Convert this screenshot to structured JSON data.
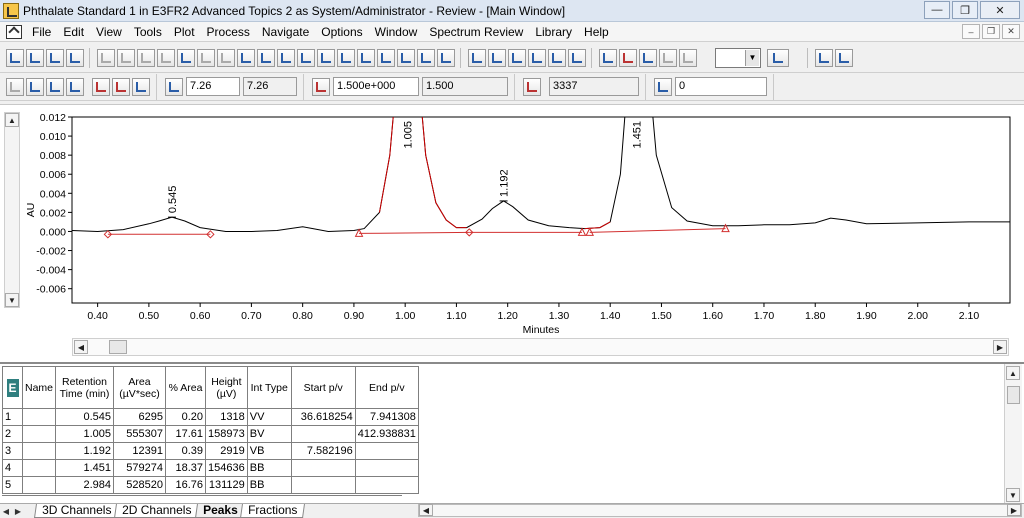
{
  "window": {
    "title": "Phthalate Standard 1 in E3FR2 Advanced Topics 2 as System/Administrator - Review - [Main Window]"
  },
  "menu": [
    "File",
    "Edit",
    "View",
    "Tools",
    "Plot",
    "Process",
    "Navigate",
    "Options",
    "Window",
    "Spectrum Review",
    "Library",
    "Help"
  ],
  "toolbar2": {
    "time_value": "7.26",
    "time_readonly": "7.26",
    "au_value": "1.500e+000",
    "au_readonly": "1.500",
    "count_value": "3337",
    "offset_value": "0"
  },
  "chart_data": {
    "type": "line",
    "xlabel": "Minutes",
    "ylabel": "AU",
    "xlim": [
      0.35,
      2.18
    ],
    "ylim": [
      -0.0075,
      0.012
    ],
    "x_ticks": [
      "0.40",
      "0.50",
      "0.60",
      "0.70",
      "0.80",
      "0.90",
      "1.00",
      "1.10",
      "1.20",
      "1.30",
      "1.40",
      "1.50",
      "1.60",
      "1.70",
      "1.80",
      "1.90",
      "2.00",
      "2.10"
    ],
    "y_ticks": [
      "0.012",
      "0.010",
      "0.008",
      "0.006",
      "0.004",
      "0.002",
      "0.000",
      "-0.002",
      "-0.004",
      "-0.006"
    ],
    "peak_labels": [
      "0.545",
      "1.005",
      "1.192",
      "1.451"
    ],
    "peak_label_x": [
      0.545,
      1.005,
      1.192,
      1.451
    ],
    "trace": {
      "color": "#000000",
      "x": [
        0.35,
        0.4,
        0.45,
        0.5,
        0.52,
        0.545,
        0.57,
        0.6,
        0.65,
        0.7,
        0.75,
        0.8,
        0.82,
        0.85,
        0.9,
        0.92,
        0.95,
        0.97,
        0.99,
        1.005,
        1.02,
        1.04,
        1.06,
        1.08,
        1.1,
        1.12,
        1.15,
        1.17,
        1.192,
        1.21,
        1.24,
        1.28,
        1.32,
        1.35,
        1.38,
        1.4,
        1.42,
        1.44,
        1.451,
        1.47,
        1.49,
        1.52,
        1.55,
        1.6,
        1.65,
        1.7,
        1.75,
        1.8,
        1.83,
        1.86,
        1.9,
        2.0,
        2.1,
        2.18
      ],
      "y": [
        0.0001,
        0.0,
        0.0002,
        0.0008,
        0.0011,
        0.0015,
        0.0011,
        0.0004,
        0.0,
        0.0,
        0.0001,
        0.0005,
        0.0003,
        0.0,
        0.0001,
        0.0003,
        0.002,
        0.008,
        0.02,
        0.03,
        0.02,
        0.008,
        0.003,
        0.0012,
        0.0004,
        0.0004,
        0.0013,
        0.0024,
        0.0032,
        0.0026,
        0.0012,
        0.0006,
        0.0004,
        0.0003,
        0.0004,
        0.001,
        0.006,
        0.02,
        0.03,
        0.02,
        0.008,
        0.0025,
        0.0011,
        0.0006,
        0.0006,
        0.0007,
        0.0007,
        0.0009,
        0.0014,
        0.0012,
        0.0008,
        0.0009,
        0.001,
        0.001
      ]
    },
    "integration_segments": [
      {
        "color": "#cc0000",
        "x": [
          0.95,
          0.97,
          0.99,
          1.005,
          1.02,
          1.04,
          1.06,
          1.08,
          1.1,
          1.12
        ],
        "y": [
          0.002,
          0.008,
          0.02,
          0.03,
          0.02,
          0.008,
          0.003,
          0.0012,
          0.0004,
          0.0004
        ]
      },
      {
        "color": "#cc0000",
        "x": [
          1.35,
          1.38,
          1.4
        ],
        "y": [
          0.0003,
          0.0004,
          0.001
        ]
      }
    ],
    "baselines": [
      {
        "x": [
          0.42,
          0.62
        ],
        "y": [
          -0.0003,
          -0.0003
        ]
      },
      {
        "x": [
          0.91,
          1.125
        ],
        "y": [
          -0.0002,
          -0.0001
        ]
      },
      {
        "x": [
          1.125,
          1.345
        ],
        "y": [
          -0.0001,
          -0.0001
        ]
      },
      {
        "x": [
          1.36,
          1.625
        ],
        "y": [
          -0.0001,
          0.0003
        ]
      }
    ],
    "markers": [
      {
        "x": 0.42,
        "y": -0.0003,
        "shape": "diamond"
      },
      {
        "x": 0.62,
        "y": -0.0003,
        "shape": "diamond"
      },
      {
        "x": 0.91,
        "y": -0.0002,
        "shape": "triangle"
      },
      {
        "x": 1.125,
        "y": -0.0001,
        "shape": "diamond"
      },
      {
        "x": 1.345,
        "y": -0.0001,
        "shape": "triangle"
      },
      {
        "x": 1.36,
        "y": -0.0001,
        "shape": "triangle"
      },
      {
        "x": 1.625,
        "y": 0.0003,
        "shape": "triangle"
      }
    ]
  },
  "peaks_table": {
    "headers": [
      "Name",
      "Retention Time (min)",
      "Area (µV*sec)",
      "% Area",
      "Height (µV)",
      "Int Type",
      "Start p/v",
      "End p/v"
    ],
    "rows": [
      {
        "n": "1",
        "name": "",
        "rt": "0.545",
        "area": "6295",
        "pct": "0.20",
        "height": "1318",
        "type": "VV",
        "start": "36.618254",
        "end": "7.941308"
      },
      {
        "n": "2",
        "name": "",
        "rt": "1.005",
        "area": "555307",
        "pct": "17.61",
        "height": "158973",
        "type": "BV",
        "start": "",
        "end": "412.938831"
      },
      {
        "n": "3",
        "name": "",
        "rt": "1.192",
        "area": "12391",
        "pct": "0.39",
        "height": "2919",
        "type": "VB",
        "start": "7.582196",
        "end": ""
      },
      {
        "n": "4",
        "name": "",
        "rt": "1.451",
        "area": "579274",
        "pct": "18.37",
        "height": "154636",
        "type": "BB",
        "start": "",
        "end": ""
      },
      {
        "n": "5",
        "name": "",
        "rt": "2.984",
        "area": "528520",
        "pct": "16.76",
        "height": "131129",
        "type": "BB",
        "start": "",
        "end": ""
      }
    ]
  },
  "tabs": [
    "3D Channels",
    "2D Channels",
    "Peaks",
    "Fractions"
  ],
  "active_tab": "Peaks"
}
